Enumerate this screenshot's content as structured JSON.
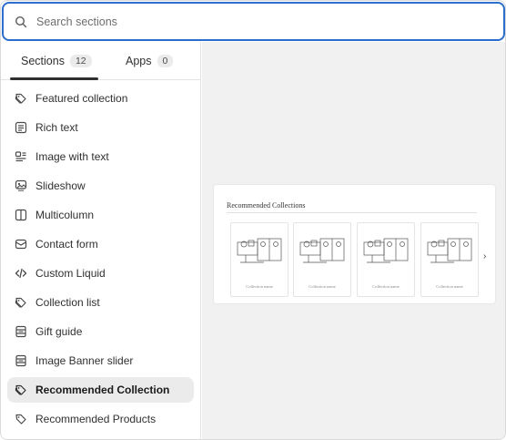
{
  "search": {
    "placeholder": "Search sections"
  },
  "tabs": [
    {
      "label": "Sections",
      "count": "12"
    },
    {
      "label": "Apps",
      "count": "0"
    }
  ],
  "items": [
    {
      "label": "Featured collection",
      "icon": "tag-icon"
    },
    {
      "label": "Rich text",
      "icon": "text-block-icon"
    },
    {
      "label": "Image with text",
      "icon": "image-with-text-icon"
    },
    {
      "label": "Slideshow",
      "icon": "slideshow-icon"
    },
    {
      "label": "Multicolumn",
      "icon": "columns-icon"
    },
    {
      "label": "Contact form",
      "icon": "envelope-icon"
    },
    {
      "label": "Custom Liquid",
      "icon": "code-icon"
    },
    {
      "label": "Collection list",
      "icon": "tag-icon"
    },
    {
      "label": "Gift guide",
      "icon": "layout-icon"
    },
    {
      "label": "Image Banner slider",
      "icon": "layout-icon"
    },
    {
      "label": "Recommended Collection",
      "icon": "tag-icon",
      "active": true
    },
    {
      "label": "Recommended Products",
      "icon": "tag-icon"
    }
  ],
  "preview": {
    "title": "Recommended Collections",
    "cards": [
      {
        "caption": "Collection name"
      },
      {
        "caption": "Collection name"
      },
      {
        "caption": "Collection name"
      },
      {
        "caption": "Collection name"
      }
    ],
    "next": "›"
  },
  "colors": {
    "accent": "#2c6ecb",
    "active_bg": "#ebebeb",
    "panel_bg": "#f1f1f1"
  }
}
